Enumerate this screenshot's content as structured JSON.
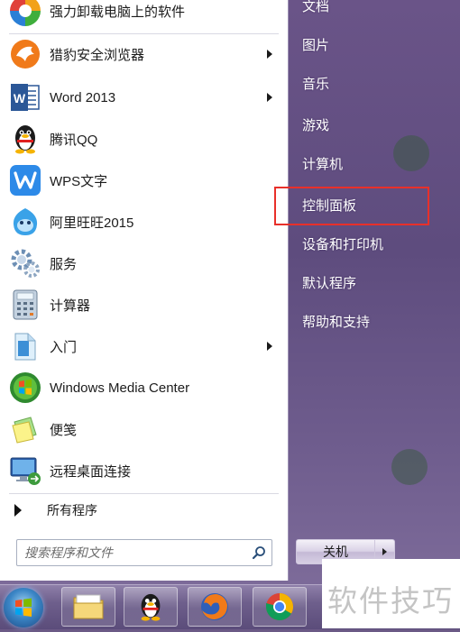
{
  "start_menu": {
    "pinned_items": [
      {
        "label": "强力卸载电脑上的软件",
        "icon": "uninstaller-icon",
        "has_submenu": false
      },
      {
        "label": "猎豹安全浏览器",
        "icon": "cheetah-browser-icon",
        "has_submenu": true
      },
      {
        "label": "Word 2013",
        "icon": "word-icon",
        "has_submenu": true
      },
      {
        "label": "腾讯QQ",
        "icon": "qq-penguin-icon",
        "has_submenu": false
      },
      {
        "label": "WPS文字",
        "icon": "wps-writer-icon",
        "has_submenu": false
      },
      {
        "label": "阿里旺旺2015",
        "icon": "aliwangwang-icon",
        "has_submenu": false
      },
      {
        "label": "服务",
        "icon": "services-gear-icon",
        "has_submenu": false
      },
      {
        "label": "计算器",
        "icon": "calculator-icon",
        "has_submenu": false
      },
      {
        "label": "入门",
        "icon": "getting-started-icon",
        "has_submenu": true
      },
      {
        "label": "Windows Media Center",
        "icon": "media-center-icon",
        "has_submenu": false
      },
      {
        "label": "便笺",
        "icon": "sticky-notes-icon",
        "has_submenu": false
      },
      {
        "label": "远程桌面连接",
        "icon": "remote-desktop-icon",
        "has_submenu": false
      }
    ],
    "all_programs_label": "所有程序",
    "search_placeholder": "搜索程序和文件",
    "right_items": [
      {
        "label": "文档"
      },
      {
        "label": "图片"
      },
      {
        "label": "音乐"
      },
      {
        "label": "游戏"
      },
      {
        "label": "计算机"
      },
      {
        "label": "控制面板",
        "highlighted": true
      },
      {
        "label": "设备和打印机"
      },
      {
        "label": "默认程序"
      },
      {
        "label": "帮助和支持"
      }
    ],
    "shutdown_label": "关机",
    "highlight_color": "#e8302a"
  },
  "taskbar": {
    "buttons": [
      {
        "icon": "file-explorer-icon"
      },
      {
        "icon": "qq-penguin-icon"
      },
      {
        "icon": "firefox-icon"
      },
      {
        "icon": "chrome-icon"
      }
    ]
  },
  "watermark": {
    "text": "软件技巧"
  }
}
